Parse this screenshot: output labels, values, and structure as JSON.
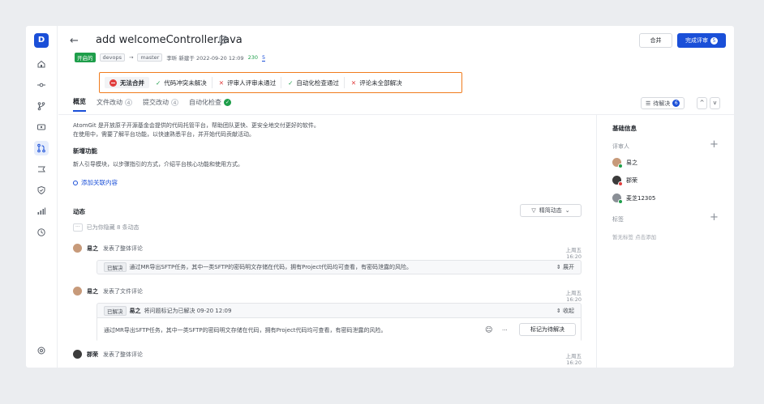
{
  "app": {
    "avatar_letter": "D"
  },
  "header": {
    "back_glyph": "←",
    "title": "add welcomeController.java",
    "status": "开启的",
    "source_branch": "devops",
    "arrow": "→",
    "target_branch": "master",
    "created": "李昕 新建于 2022-09-20 12:09",
    "lines_added": "230",
    "lines_removed": "5",
    "merge_label": "合并",
    "review_label": "完成评审",
    "review_count": "5",
    "more_glyph": "···"
  },
  "checks": [
    {
      "label": "无法合并",
      "state": "blocked"
    },
    {
      "label": "代码冲突未解决",
      "state": "ok"
    },
    {
      "label": "评审人评审未通过",
      "state": "fail"
    },
    {
      "label": "自动化检查通过",
      "state": "ok"
    },
    {
      "label": "评论未全部解决",
      "state": "fail"
    }
  ],
  "tabs": [
    {
      "label": "概览"
    },
    {
      "label": "文件改动",
      "count": "4"
    },
    {
      "label": "提交改动",
      "count": "4"
    },
    {
      "label": "自动化检查"
    }
  ],
  "todo": {
    "label": "待解决",
    "count": "6",
    "up": "^",
    "down": "v"
  },
  "overview": {
    "desc_line1": "AtomGit 是开放原子开源基金会提供的代码托管平台，帮助团队更快、更安全地交付更好的软件。",
    "desc_line2": "在使用中，需要了解平台功能，以快速熟悉平台，并开始代码贡献活动。",
    "feature_heading": "新增功能",
    "feature_desc": "新人引导模块，以步骤指引的方式，介绍平台核心功能和使用方式。",
    "add_link": "添加关联内容"
  },
  "activity": {
    "heading": "动态",
    "filter_label": "精简动态",
    "hidden_note": "已为你隐藏 8 条动态",
    "items": [
      {
        "user": "易之",
        "action": "发表了整体评论",
        "time": "上周五 16:20",
        "badge": "已解决",
        "text": "通过MR导出SFTP任务，其中一类SFTP的密码明文存储在代码，拥有Project代码均可查看，有密码泄露的风险。",
        "toggle": "展开"
      },
      {
        "user": "易之",
        "action": "发表了文件评论",
        "time": "上周五 16:20",
        "badge": "已解决",
        "resolve_note_user": "易之",
        "resolve_note": "将问题标记为已解决 09-20 12:09",
        "toggle": "收起",
        "text": "通过MR导出SFTP任务，其中一类SFTP的密码明文存储在代码，拥有Project代码均可查看，有密码泄露的风险。",
        "mark_btn": "标记为待解决"
      },
      {
        "user": "郡荣",
        "action": "发表了整体评论",
        "time": "上周五 16:20"
      }
    ]
  },
  "sidebar": {
    "heading": "基础信息",
    "reviewers_label": "评审人",
    "reviewers": [
      {
        "name": "易之",
        "status": "approved"
      },
      {
        "name": "郡荣",
        "status": "rejected"
      },
      {
        "name": "麦芝12305",
        "status": "approved"
      }
    ],
    "tags_label": "标签",
    "tags_empty": "暂无标签 点击添加",
    "plus": "+"
  },
  "colors": {
    "accent": "#1a4fd8",
    "success": "#1e9e4a",
    "danger": "#e13d3d",
    "highlight": "#f07b1d"
  }
}
